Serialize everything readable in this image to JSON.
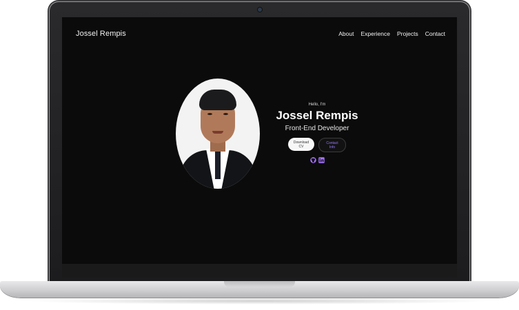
{
  "site": {
    "brand": "Jossel Rempis",
    "nav": [
      "About",
      "Experience",
      "Projects",
      "Contact"
    ]
  },
  "hero": {
    "greeting": "Hello, I'm",
    "name": "Jossel Rempis",
    "role": "Front-End Developer",
    "buttons": {
      "download_cv": "Download CV",
      "contact_info": "Contact Info"
    },
    "socials": [
      "github-icon",
      "linkedin-icon"
    ],
    "colors": {
      "background": "#0b0b0b",
      "accent": "#9a7bff"
    }
  }
}
